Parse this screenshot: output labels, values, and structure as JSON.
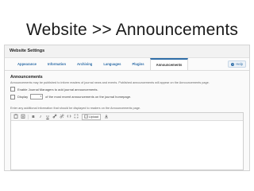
{
  "slide": {
    "title": "Website  >>  Announcements"
  },
  "panel": {
    "header": "Website Settings",
    "tabs": [
      "Appearance",
      "Information",
      "Archiving",
      "Languages",
      "Plugins",
      "Announcements"
    ],
    "active_tab": "Announcements",
    "help_label": "Help"
  },
  "announcements": {
    "title": "Announcements",
    "description": "Announcements may be published to inform readers of journal news and events. Published announcements will appear on the Announcements page.",
    "enable_label": "Enable Journal Managers to add journal announcements.",
    "display_prefix": "Display",
    "display_suffix": "of the most recent announcements on the journal homepage.",
    "extra_info_prompt": "Enter any additional information that should be displayed to readers on the Announcements page."
  },
  "editor": {
    "toolbar": {
      "paste_icon": "clipboard-icon",
      "bold": "B",
      "italic": "I",
      "underline": "U",
      "upload_label": "Upload"
    }
  }
}
